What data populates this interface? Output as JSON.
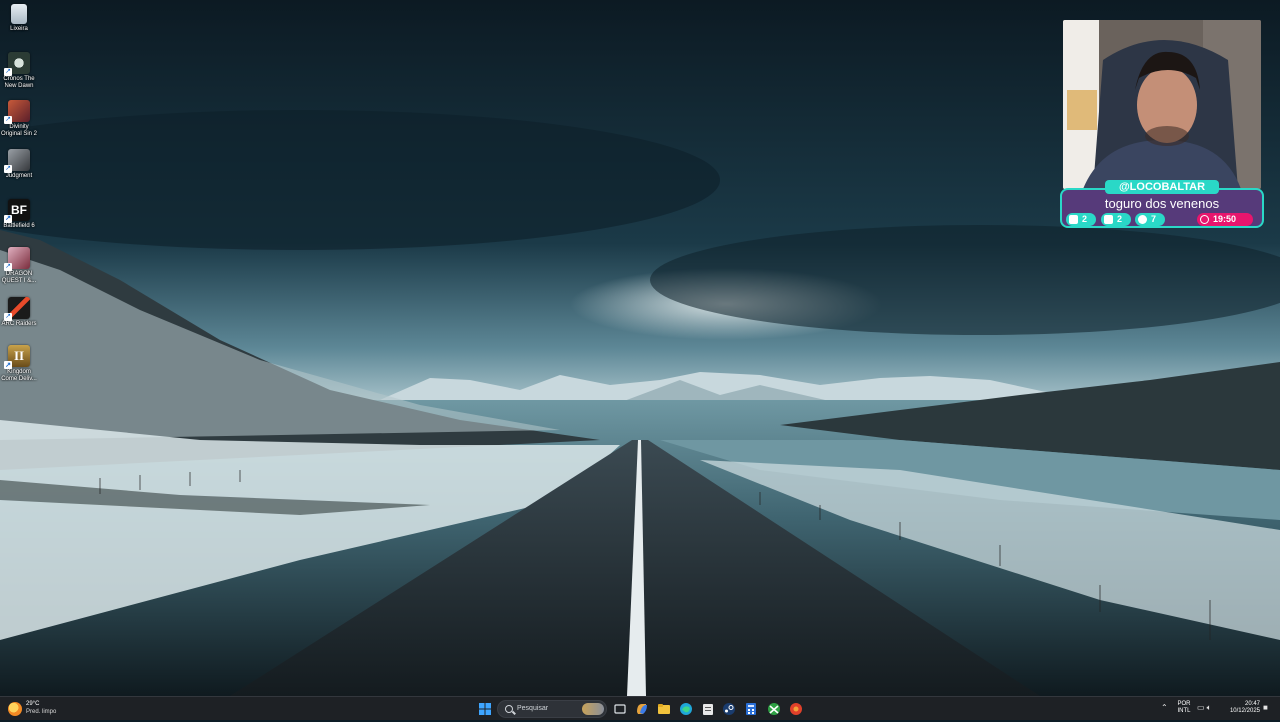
{
  "desktop": {
    "icons": [
      {
        "label": "Lixeira",
        "icon": "recycle-bin-icon",
        "color": "#cfd8e0"
      },
      {
        "label": "Cronos The New Dawn",
        "icon": "cronos-game-icon",
        "color": "#2b3b34"
      },
      {
        "label": "Divinity Original Sin 2",
        "icon": "divinity-game-icon",
        "color": "#7a3a2a"
      },
      {
        "label": "Judgment",
        "icon": "judgment-game-icon",
        "color": "#55585c"
      },
      {
        "label": "Battlefield 6",
        "icon": "battlefield-game-icon",
        "color": "#111111"
      },
      {
        "label": "DRAGON QUEST I &...",
        "icon": "dragon-quest-game-icon",
        "color": "#7a2c3c"
      },
      {
        "label": "ARC Raiders",
        "icon": "arc-raiders-game-icon",
        "color": "#1b1b1b"
      },
      {
        "label": "Kingdom Come Deliv...",
        "icon": "kingdom-come-game-icon",
        "color": "#8a6c2a"
      }
    ]
  },
  "stream_overlay": {
    "handle": "@LOCOBALTAR",
    "title": "toguro dos venenos",
    "stats": [
      {
        "icon": "twitch-icon",
        "value": "2"
      },
      {
        "icon": "youtube-icon",
        "value": "2"
      },
      {
        "icon": "kick-icon",
        "value": "7"
      }
    ],
    "timer": "19:50",
    "accent": "#2ad8c7",
    "card_color": "#563a7a",
    "timer_color": "#e8156d"
  },
  "taskbar": {
    "weather": {
      "temp": "29°C",
      "condition": "Pred. limpo"
    },
    "search_placeholder": "Pesquisar",
    "apps": [
      "windows-start-icon",
      "task-view-icon",
      "copilot-icon",
      "file-explorer-icon",
      "edge-browser-icon",
      "notepad-icon",
      "steam-icon",
      "calculator-icon",
      "xbox-icon",
      "red-app-icon"
    ],
    "language": {
      "line1": "POR",
      "line2": "INTL"
    },
    "clock": {
      "time": "20:47",
      "date": "10/12/2025"
    }
  }
}
